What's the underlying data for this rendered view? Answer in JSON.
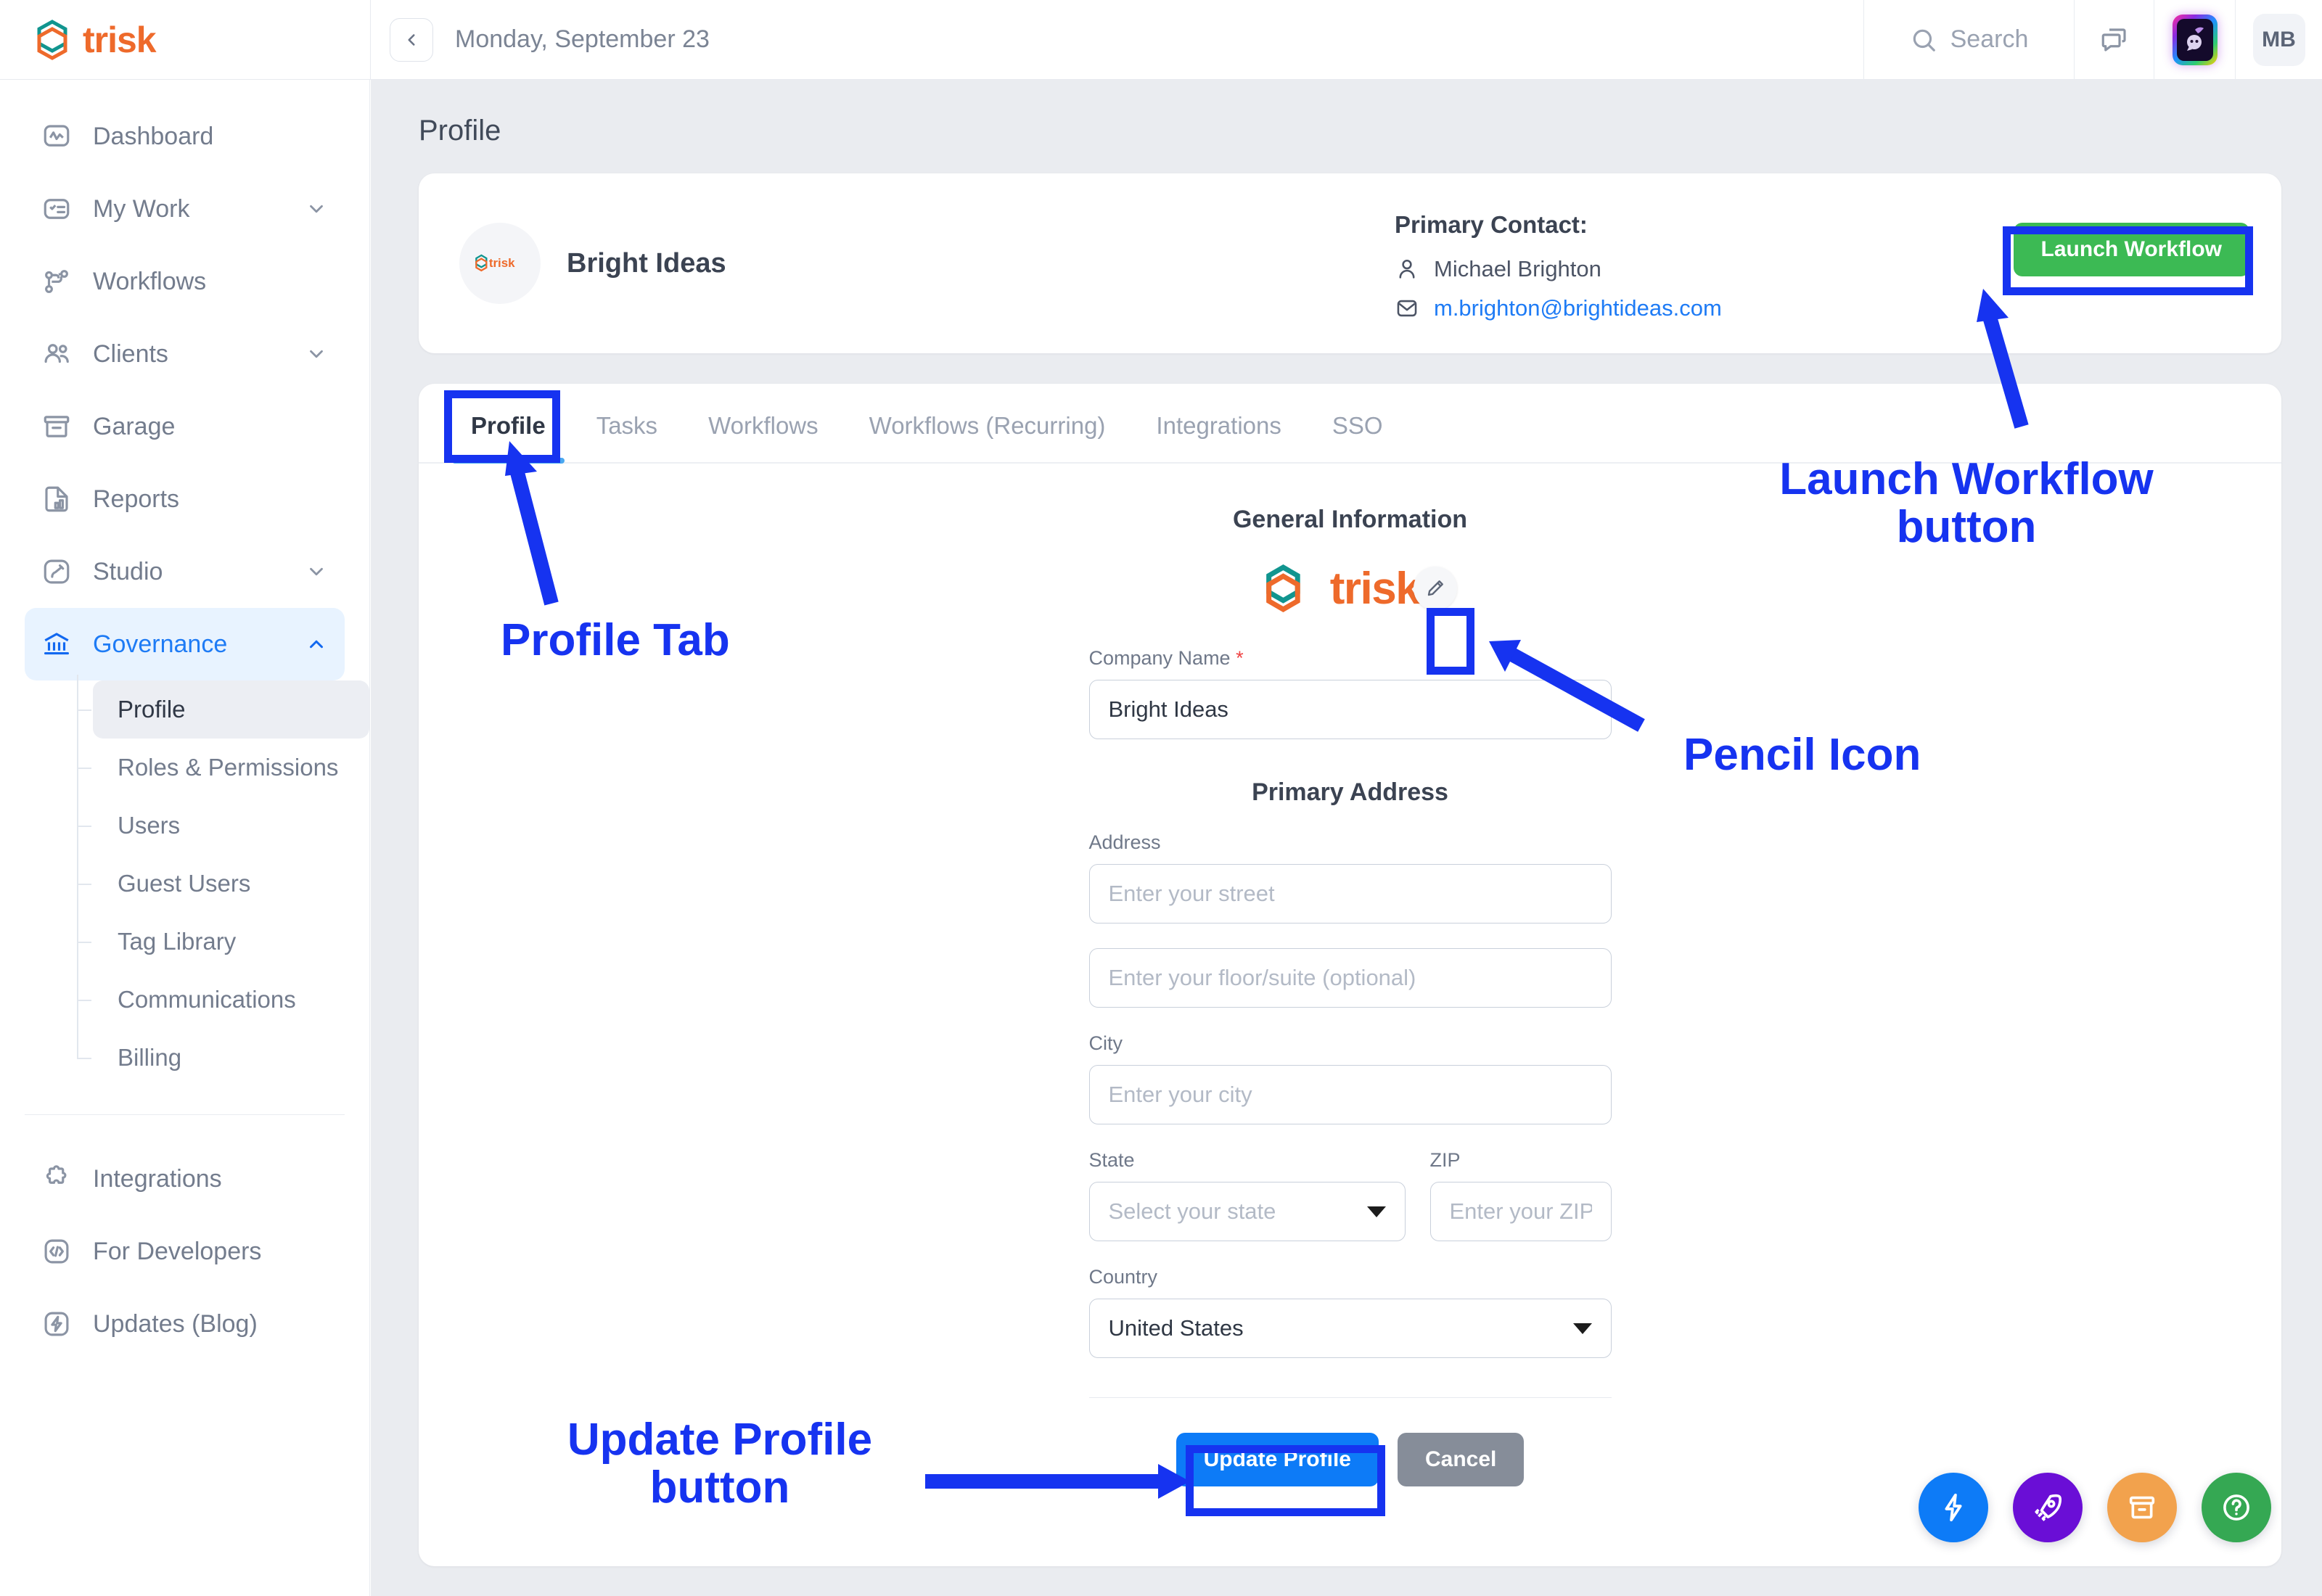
{
  "brand": {
    "name": "trisk",
    "accent": "#ee6a2b",
    "mark_teal": "#11958f"
  },
  "topbar": {
    "date": "Monday, September 23",
    "search_placeholder": "Search",
    "collapse_icon": "chevron-left-icon",
    "chat_icon": "chat-bubbles-icon",
    "ai_icon": "ai-assistant-icon",
    "avatar_initials": "MB"
  },
  "sidebar": {
    "items": [
      {
        "label": "Dashboard",
        "icon": "dashboard-icon",
        "expandable": false
      },
      {
        "label": "My Work",
        "icon": "checklist-icon",
        "expandable": true
      },
      {
        "label": "Workflows",
        "icon": "workflow-nodes-icon",
        "expandable": false
      },
      {
        "label": "Clients",
        "icon": "people-icon",
        "expandable": true
      },
      {
        "label": "Garage",
        "icon": "archive-box-icon",
        "expandable": false
      },
      {
        "label": "Reports",
        "icon": "report-chart-icon",
        "expandable": false
      },
      {
        "label": "Studio",
        "icon": "paint-brush-icon",
        "expandable": true
      },
      {
        "label": "Governance",
        "icon": "bank-columns-icon",
        "expandable": true,
        "active": true,
        "expanded": true
      }
    ],
    "governance_children": [
      {
        "label": "Profile",
        "active": true
      },
      {
        "label": "Roles & Permissions",
        "active": false
      },
      {
        "label": "Users",
        "active": false
      },
      {
        "label": "Guest Users",
        "active": false
      },
      {
        "label": "Tag Library",
        "active": false
      },
      {
        "label": "Communications",
        "active": false
      },
      {
        "label": "Billing",
        "active": false
      }
    ],
    "footer_items": [
      {
        "label": "Integrations",
        "icon": "puzzle-piece-icon"
      },
      {
        "label": "For Developers",
        "icon": "code-brackets-icon"
      },
      {
        "label": "Updates (Blog)",
        "icon": "lightning-bolt-icon"
      }
    ]
  },
  "page": {
    "title": "Profile"
  },
  "profile_header": {
    "company_name": "Bright Ideas",
    "company_logo": "trisk-logo-icon",
    "primary_contact_label": "Primary Contact:",
    "contact_name": "Michael Brighton",
    "contact_email": "m.brighton@brightideas.com",
    "person_icon": "person-icon",
    "email_icon": "envelope-icon",
    "launch_button": "Launch Workflow",
    "launch_button_color": "#3cba54"
  },
  "tabs": [
    {
      "label": "Profile",
      "active": true
    },
    {
      "label": "Tasks",
      "active": false
    },
    {
      "label": "Workflows",
      "active": false
    },
    {
      "label": "Workflows (Recurring)",
      "active": false
    },
    {
      "label": "Integrations",
      "active": false
    },
    {
      "label": "SSO",
      "active": false
    }
  ],
  "form": {
    "general_information_title": "General Information",
    "logo_text": "trisk",
    "edit_logo_icon": "pencil-icon",
    "company_name_label": "Company Name",
    "company_name_required_marker": "*",
    "company_name_value": "Bright Ideas",
    "primary_address_title": "Primary Address",
    "address_label": "Address",
    "street_placeholder": "Enter your street",
    "floor_placeholder": "Enter your floor/suite (optional)",
    "city_label": "City",
    "city_placeholder": "Enter your city",
    "state_label": "State",
    "state_placeholder": "Select your state",
    "zip_label": "ZIP",
    "zip_placeholder": "Enter your ZIP",
    "country_label": "Country",
    "country_value": "United States",
    "update_button": "Update Profile",
    "cancel_button": "Cancel"
  },
  "fabs": [
    {
      "icon": "lightning-bolt-icon",
      "color": "#0d7bf7"
    },
    {
      "icon": "rocket-icon",
      "color": "#6a0ed6"
    },
    {
      "icon": "archive-box-icon",
      "color": "#f2a24d"
    },
    {
      "icon": "question-mark-icon",
      "color": "#35a853"
    }
  ],
  "annotations": {
    "color": "#1633f0",
    "launch_workflow": "Launch Workflow\nbutton",
    "launch_workflow_line1": "Launch Workflow",
    "launch_workflow_line2": "button",
    "profile_tab": "Profile Tab",
    "pencil_icon": "Pencil Icon",
    "update_profile_line1": "Update Profile",
    "update_profile_line2": "button"
  }
}
